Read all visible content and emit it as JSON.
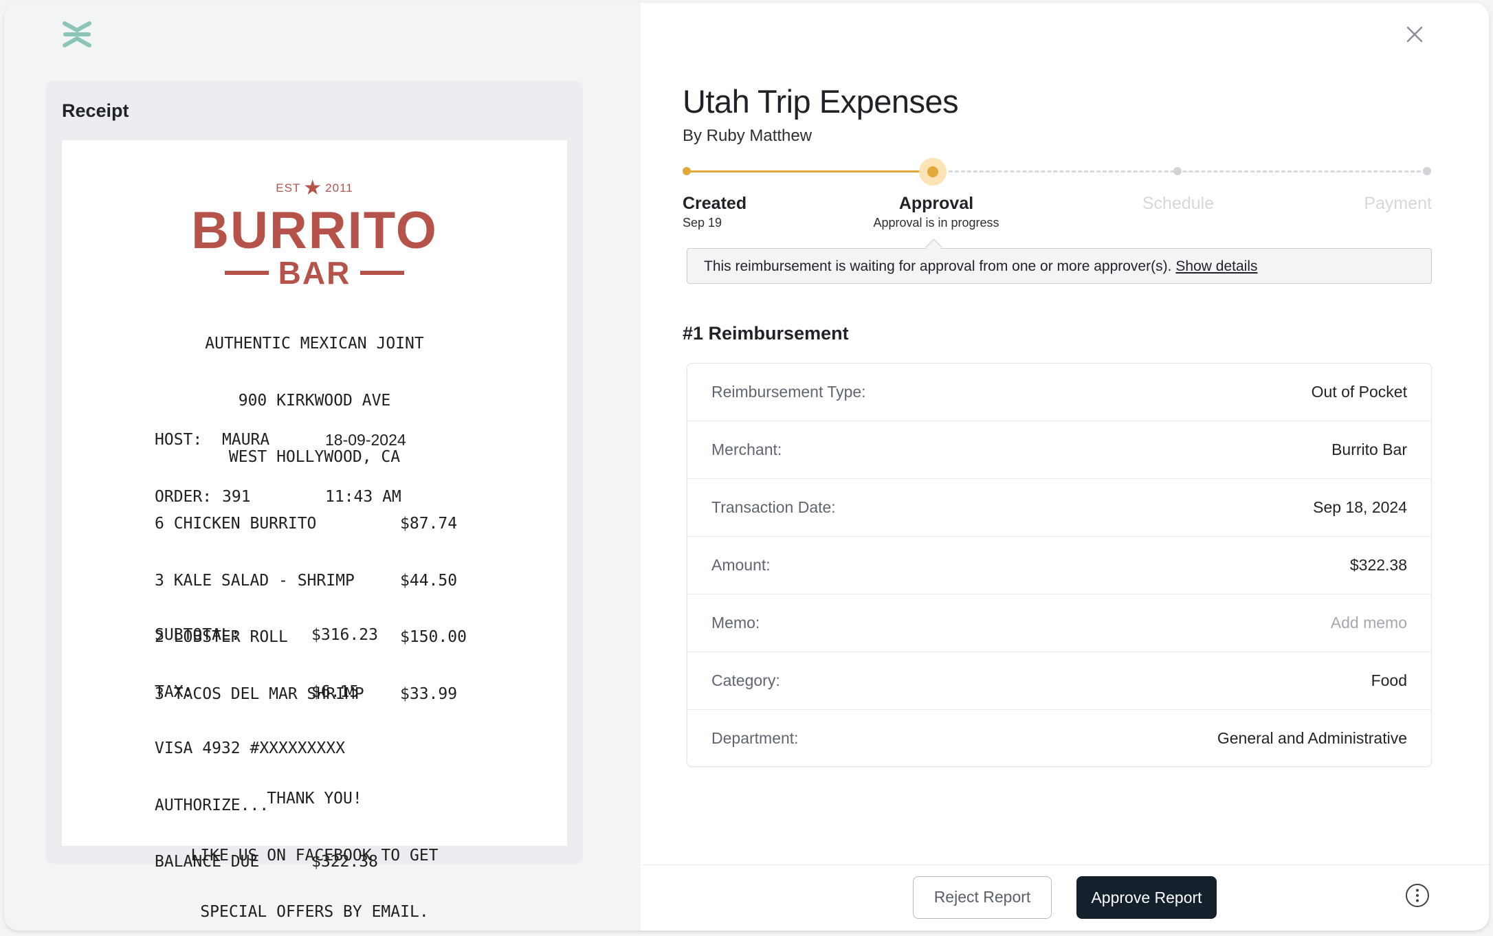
{
  "receipt_panel": {
    "title": "Receipt",
    "receipt": {
      "est_prefix": "EST",
      "est_year": "2011",
      "brand_line1": "BURRITO",
      "brand_line2": "BAR",
      "address": [
        "AUTHENTIC MEXICAN JOINT",
        "900 KIRKWOOD AVE",
        "WEST HOLLYWOOD, CA"
      ],
      "host_label": "HOST:",
      "host_value": "MAURA",
      "date": "18-09-2024",
      "order_label": "ORDER:",
      "order_value": "391",
      "time": "11:43 AM",
      "items": [
        {
          "name": "6 CHICKEN BURRITO",
          "price": "$87.74"
        },
        {
          "name": "3 KALE SALAD - SHRIMP",
          "price": "$44.50"
        },
        {
          "name": "2 LOBSTER ROLL",
          "price": "$150.00"
        },
        {
          "name": "3 TACOS DEL MAR SHRIMP",
          "price": "$33.99"
        }
      ],
      "subtotal_label": "SUBTOTAL:",
      "subtotal_value": "$316.23",
      "tax_label": "TAX:",
      "tax_value": "$6.15",
      "card_line": "VISA 4932 #XXXXXXXXX",
      "authorize_line": "AUTHORIZE...",
      "balance_label": "BALANCE DUE",
      "balance_value": "$322.38",
      "thanks": [
        "THANK YOU!",
        "LIKE US ON FACEBOOK TO GET",
        "SPECIAL OFFERS BY EMAIL."
      ]
    }
  },
  "report": {
    "title": "Utah Trip Expenses",
    "author": "By Ruby Matthew",
    "steps": [
      {
        "label": "Created",
        "sub": "Sep 19",
        "state": "done"
      },
      {
        "label": "Approval",
        "sub": "Approval is in progress",
        "state": "active"
      },
      {
        "label": "Schedule",
        "sub": "",
        "state": "todo"
      },
      {
        "label": "Payment",
        "sub": "",
        "state": "todo"
      }
    ],
    "banner_text": "This reimbursement is waiting for approval from one or more approver(s).",
    "banner_link": "Show details",
    "section_title": "#1 Reimbursement",
    "details": [
      {
        "label": "Reimbursement Type:",
        "value": "Out of Pocket"
      },
      {
        "label": "Merchant:",
        "value": "Burrito Bar"
      },
      {
        "label": "Transaction Date:",
        "value": "Sep 18, 2024"
      },
      {
        "label": "Amount:",
        "value": "$322.38"
      },
      {
        "label": "Memo:",
        "value": "Add memo",
        "placeholder": true
      },
      {
        "label": "Category:",
        "value": "Food"
      },
      {
        "label": "Department:",
        "value": "General and Administrative"
      }
    ]
  },
  "footer": {
    "reject_label": "Reject Report",
    "approve_label": "Approve Report"
  },
  "colors": {
    "accent": "#e3a83a",
    "brand_red": "#b5534b",
    "logo_teal": "#8cc4b8",
    "primary_button": "#14202b"
  },
  "icons": [
    "app-logo-icon",
    "close-icon",
    "star-icon",
    "more-options-icon"
  ]
}
